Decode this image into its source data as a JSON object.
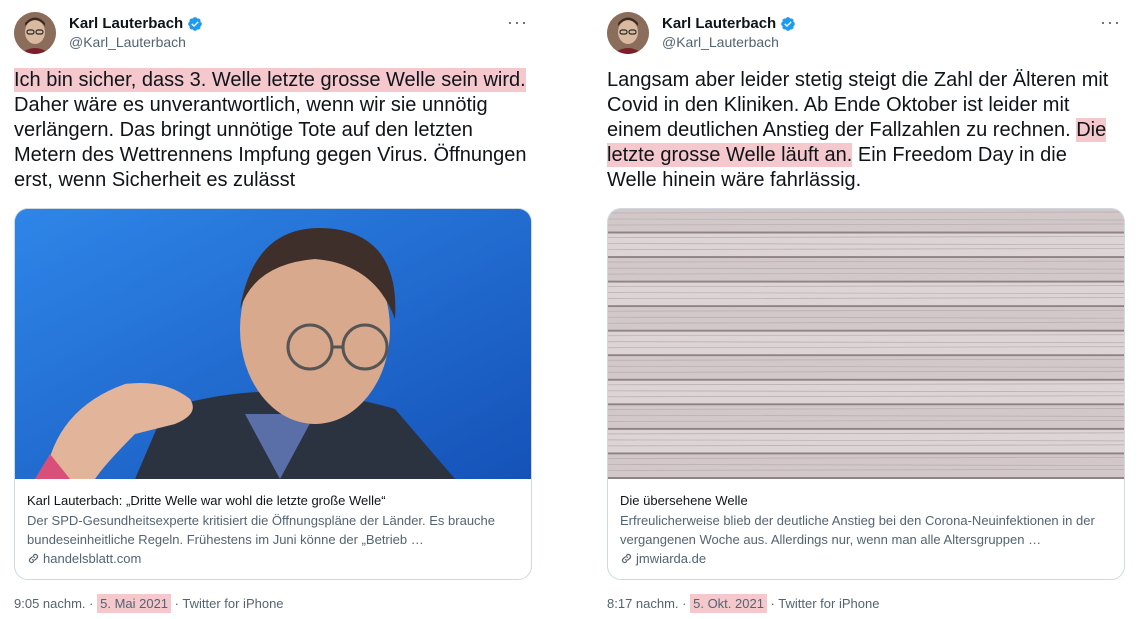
{
  "tweets": [
    {
      "author": {
        "name": "Karl Lauterbach",
        "handle": "@Karl_Lauterbach"
      },
      "more_label": "···",
      "text": {
        "highlight": "Ich bin sicher, dass 3. Welle letzte grosse Welle sein wird.",
        "rest": " Daher wäre es unverantwortlich, wenn wir sie unnötig verlängern. Das bringt unnötige Tote auf den letzten Metern des Wettrennens Impfung gegen Virus. Öffnungen erst, wenn Sicherheit es zulässt"
      },
      "card": {
        "title": "Karl Lauterbach: „Dritte Welle war wohl die letzte große Welle“",
        "description": "Der SPD-Gesundheitsexperte kritisiert die Öffnungspläne der Länder. Es brauche bundeseinheitliche Regeln. Frühestens im Juni könne der „Betrieb …",
        "domain": "handelsblatt.com"
      },
      "meta": {
        "time": "9:05 nachm.",
        "sep1": " · ",
        "date": "5. Mai 2021",
        "sep2": " · ",
        "source": "Twitter for iPhone"
      }
    },
    {
      "author": {
        "name": "Karl Lauterbach",
        "handle": "@Karl_Lauterbach"
      },
      "more_label": "···",
      "text": {
        "before": "Langsam aber leider stetig steigt die Zahl der Älteren mit Covid in den Kliniken. Ab Ende Oktober ist leider mit einem deutlichen Anstieg der Fallzahlen zu rechnen. ",
        "highlight": "Die letzte grosse Welle läuft an.",
        "after": " Ein Freedom Day in die Welle hinein wäre fahrlässig."
      },
      "card": {
        "title": "Die übersehene Welle",
        "description": "Erfreulicherweise blieb der deutliche Anstieg bei den Corona-Neuinfektionen in der vergangenen Woche aus. Allerdings nur, wenn man alle Altersgruppen …",
        "domain": "jmwiarda.de"
      },
      "meta": {
        "time": "8:17 nachm.",
        "sep1": " · ",
        "date": "5. Okt. 2021",
        "sep2": " · ",
        "source": "Twitter for iPhone"
      }
    }
  ],
  "colors": {
    "highlight": "#f4c8cc",
    "verified": "#1d9bf0",
    "photo_bg": "#1f6fd6",
    "wood": "#d8d0d2"
  }
}
